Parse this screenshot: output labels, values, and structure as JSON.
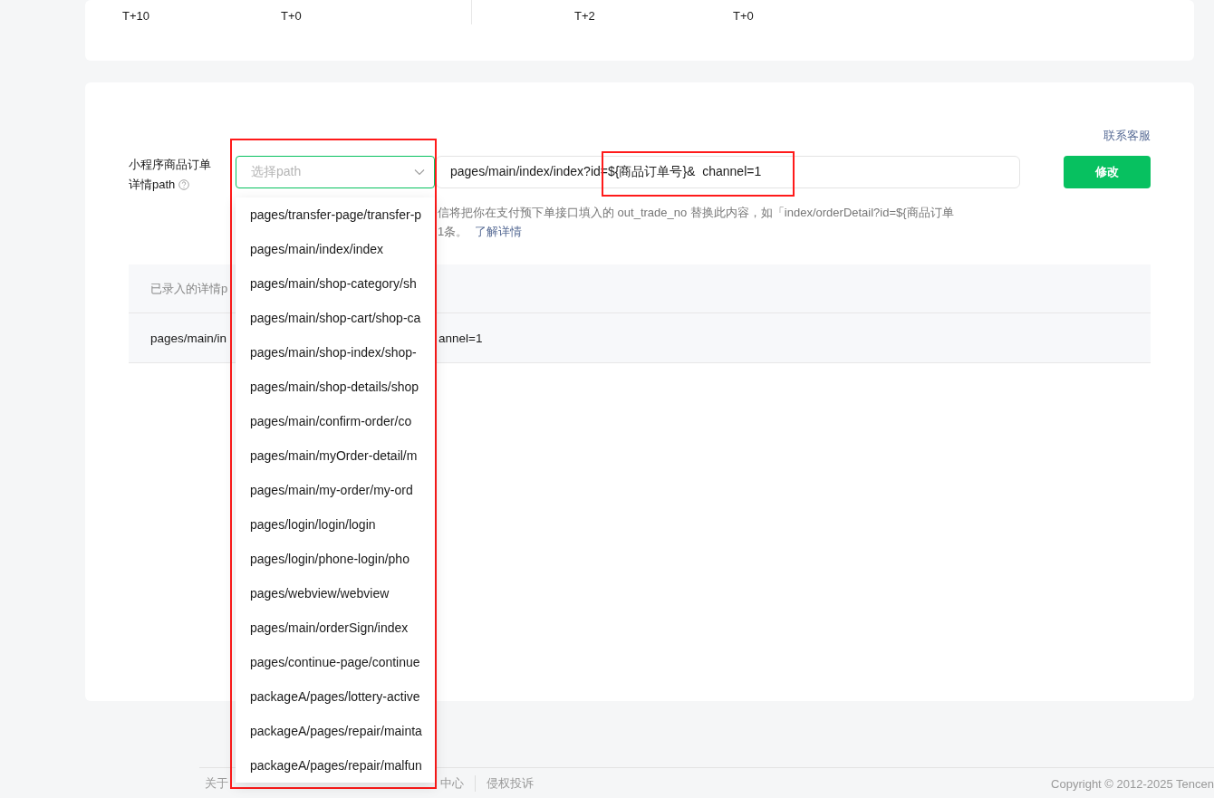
{
  "top_card": {
    "groups": [
      {
        "fields": [
          {
            "value": "T+10"
          },
          {
            "value": "T+0"
          }
        ]
      },
      {
        "fields": [
          {
            "value": "T+2"
          },
          {
            "value": "T+0"
          }
        ]
      }
    ]
  },
  "config_card": {
    "contact_link": "联系客服",
    "form": {
      "label_lines": [
        "小程序商品订单",
        "详情path"
      ],
      "select": {
        "placeholder": "选择path",
        "focused": true
      },
      "path_input": {
        "value": "pages/main/index/index?id=${商品订单号}&  channel=1"
      },
      "submit_button": "修改",
      "hint_lines": [
        "信将把你在支付预下单接口填入的 out_trade_no 替换此内容，如「index/orderDetail?id=${商品订单",
        "1条。"
      ],
      "hint_link": "了解详情"
    },
    "table": {
      "header": "已录入的详情p",
      "row": {
        "cell_left": "pages/main/in",
        "cell_right": "annel=1"
      }
    }
  },
  "dropdown": {
    "options": [
      "pages/transfer-page/transfer-p",
      "pages/main/index/index",
      "pages/main/shop-category/sh",
      "pages/main/shop-cart/shop-ca",
      "pages/main/shop-index/shop-",
      "pages/main/shop-details/shop",
      "pages/main/confirm-order/co",
      "pages/main/myOrder-detail/m",
      "pages/main/my-order/my-ord",
      "pages/login/login/login",
      "pages/login/phone-login/pho",
      "pages/webview/webview",
      "pages/main/orderSign/index",
      "pages/continue-page/continue",
      "packageA/pages/lottery-active",
      "packageA/pages/repair/mainta",
      "packageA/pages/repair/malfun"
    ]
  },
  "footer": {
    "links": [
      "关于",
      "中心",
      "侵权投诉"
    ],
    "copyright": "Copyright © 2012-2025 Tencen"
  }
}
